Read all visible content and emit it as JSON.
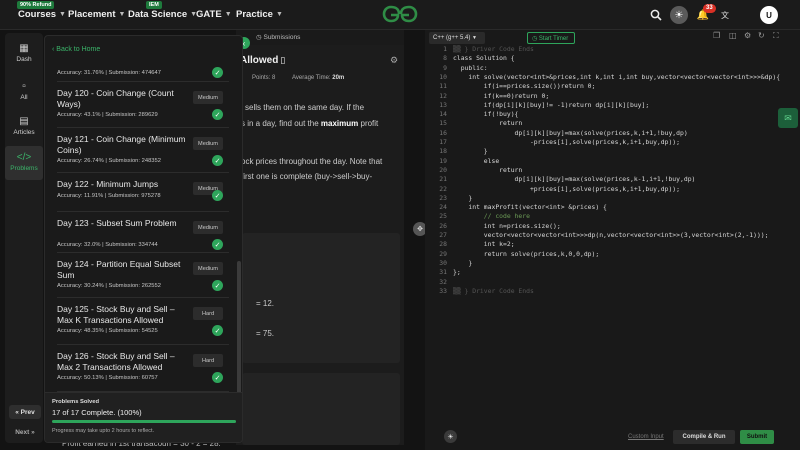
{
  "topnav": {
    "badge_refund": "90% Refund",
    "courses": "Courses",
    "placement": "Placement",
    "badge_iem": "IEM",
    "data_science": "Data Science",
    "gate": "GATE",
    "practice": "Practice",
    "notif_count": "33",
    "avatar": "U"
  },
  "rail": {
    "dash": "Dash",
    "all": "All",
    "articles": "Articles",
    "problems": "Problems",
    "prev": "Prev",
    "next": "Next"
  },
  "list": {
    "back": "Back to Home",
    "first_meta": "Accuracy: 31.76% | Submission: 474647",
    "items": [
      {
        "title": "Day 120 - Coin Change (Count Ways)",
        "difficulty": "Medium",
        "meta": "Accuracy: 43.1% | Submission: 289629"
      },
      {
        "title": "Day 121 - Coin Change (Minimum Coins)",
        "difficulty": "Medium",
        "meta": "Accuracy: 26.74% | Submission: 248352"
      },
      {
        "title": "Day 122 - Minimum Jumps",
        "difficulty": "Medium",
        "meta": "Accuracy: 11.91% | Submission: 975278"
      },
      {
        "title": "Day 123 - Subset Sum Problem",
        "difficulty": "Medium",
        "meta": "Accuracy: 32.0% | Submission: 334744"
      },
      {
        "title": "Day 124 - Partition Equal Subset Sum",
        "difficulty": "Medium",
        "meta": "Accuracy: 30.24% | Submission: 262552"
      },
      {
        "title": "Day 125 - Stock Buy and Sell – Max K Transactions Allowed",
        "difficulty": "Hard",
        "meta": "Accuracy: 48.35% | Submission: 54525"
      },
      {
        "title": "Day 126 - Stock Buy and Sell – Max 2 Transactions Allowed",
        "difficulty": "Hard",
        "meta": "Accuracy: 50.13% | Submission: 60757"
      }
    ],
    "solved_label": "Problems Solved",
    "solved_text": "17 of 17 Complete. (100%)",
    "progress": 1.0,
    "solved_note": "Progress may take upto 2 hours to reflect."
  },
  "problem": {
    "submissions_tab": "Submissions",
    "title_fragment": "Allowed",
    "points": "Points: 8",
    "avg_time_label": "Average Time:",
    "avg_time_value": "20m",
    "desc_line1": "l sells them on the same day. If the",
    "desc_line2a": "s in a day, find out the ",
    "desc_line2b": "maximum",
    "desc_line2c": " profit",
    "desc_line3": "ock prices throughout the day. Note that",
    "desc_line4": "first one is complete (buy->sell->buy-",
    "eq1": "= 12.",
    "eq2": "= 75.",
    "bottom_line": "Profit earned in 1st transacoun = 30 - 2 = 28."
  },
  "editor": {
    "language": "C++ (g++ 5.4)",
    "start_timer": "Start Timer",
    "lines": [
      {
        "n": "1",
        "c": "▒▒ } Driver Code Ends"
      },
      {
        "n": "8",
        "c": "class Solution {"
      },
      {
        "n": "9",
        "c": "  public:"
      },
      {
        "n": "10",
        "c": "    int solve(vector<int>&prices,int k,int i,int buy,vector<vector<vector<int>>>&dp){"
      },
      {
        "n": "11",
        "c": "        if(i==prices.size())return 0;"
      },
      {
        "n": "12",
        "c": "        if(k==0)return 0;"
      },
      {
        "n": "13",
        "c": "        if(dp[i][k][buy]!= -1)return dp[i][k][buy];"
      },
      {
        "n": "14",
        "c": "        if(!buy){"
      },
      {
        "n": "15",
        "c": "            return"
      },
      {
        "n": "16",
        "c": "                dp[i][k][buy]=max(solve(prices,k,i+1,!buy,dp)"
      },
      {
        "n": "17",
        "c": "                    -prices[i],solve(prices,k,i+1,buy,dp));"
      },
      {
        "n": "18",
        "c": "        }"
      },
      {
        "n": "19",
        "c": "        else"
      },
      {
        "n": "20",
        "c": "            return"
      },
      {
        "n": "21",
        "c": "                dp[i][k][buy]=max(solve(prices,k-1,i+1,!buy,dp)"
      },
      {
        "n": "22",
        "c": "                    +prices[i],solve(prices,k,i+1,buy,dp));"
      },
      {
        "n": "23",
        "c": "    }"
      },
      {
        "n": "24",
        "c": "    int maxProfit(vector<int> &prices) {"
      },
      {
        "n": "25",
        "c": "        // code here"
      },
      {
        "n": "26",
        "c": "        int n=prices.size();"
      },
      {
        "n": "27",
        "c": "        vector<vector<vector<int>>>dp(n,vector<vector<int>>(3,vector<int>(2,-1)));"
      },
      {
        "n": "28",
        "c": "        int k=2;"
      },
      {
        "n": "29",
        "c": "        return solve(prices,k,0,0,dp);"
      },
      {
        "n": "30",
        "c": "    }"
      },
      {
        "n": "31",
        "c": "};"
      },
      {
        "n": "32",
        "c": ""
      },
      {
        "n": "33",
        "c": "▒▒ } Driver Code Ends"
      }
    ],
    "custom_input": "Custom Input",
    "compile_run": "Compile & Run",
    "submit": "Submit"
  },
  "colors": {
    "accent": "#2f8d46",
    "bg": "#131313"
  }
}
